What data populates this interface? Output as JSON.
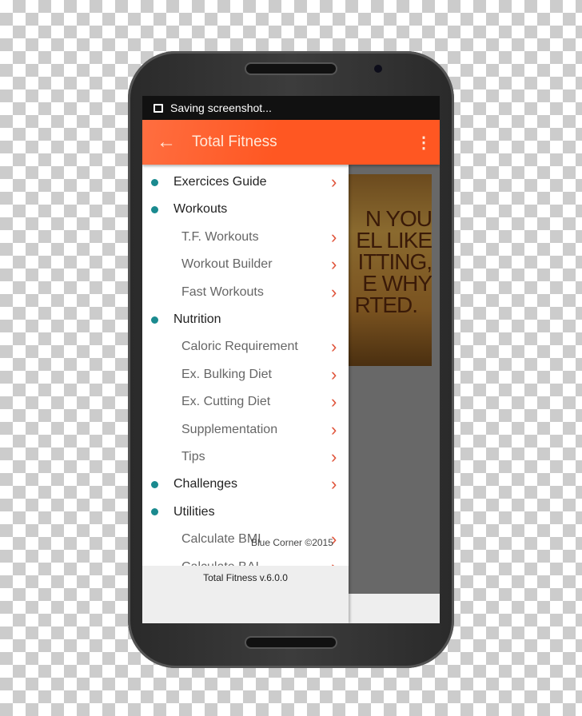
{
  "status_bar": {
    "notification": "Saving screenshot...",
    "icon": "image-icon"
  },
  "app_bar": {
    "title": "Total Fitness",
    "back_icon": "arrow-left-icon",
    "menu_icon": "more-vert-icon",
    "color": "#ff5722"
  },
  "background_image": {
    "lines": [
      "N YOU",
      "EL LIKE",
      "ITTING,",
      "E WHY",
      "RTED."
    ]
  },
  "drawer": {
    "items": [
      {
        "label": "Exercices Guide",
        "level": 0,
        "chevron": true
      },
      {
        "label": "Workouts",
        "level": 0,
        "chevron": false
      },
      {
        "label": "T.F. Workouts",
        "level": 1,
        "chevron": true
      },
      {
        "label": "Workout Builder",
        "level": 1,
        "chevron": true
      },
      {
        "label": "Fast Workouts",
        "level": 1,
        "chevron": true
      },
      {
        "label": "Nutrition",
        "level": 0,
        "chevron": false
      },
      {
        "label": "Caloric Requirement",
        "level": 1,
        "chevron": true
      },
      {
        "label": "Ex. Bulking Diet",
        "level": 1,
        "chevron": true
      },
      {
        "label": "Ex. Cutting Diet",
        "level": 1,
        "chevron": true
      },
      {
        "label": "Supplementation",
        "level": 1,
        "chevron": true
      },
      {
        "label": "Tips",
        "level": 1,
        "chevron": true
      },
      {
        "label": "Challenges",
        "level": 0,
        "chevron": true
      },
      {
        "label": "Utilities",
        "level": 0,
        "chevron": false
      },
      {
        "label": "Calculate BMI",
        "level": 1,
        "chevron": true
      },
      {
        "label": "Calculate BAI",
        "level": 1,
        "chevron": true
      }
    ],
    "version": "Total Fitness v.6.0.0",
    "bullet_color": "#1a8a8f"
  },
  "copyright": "Blue Corner ©2015"
}
